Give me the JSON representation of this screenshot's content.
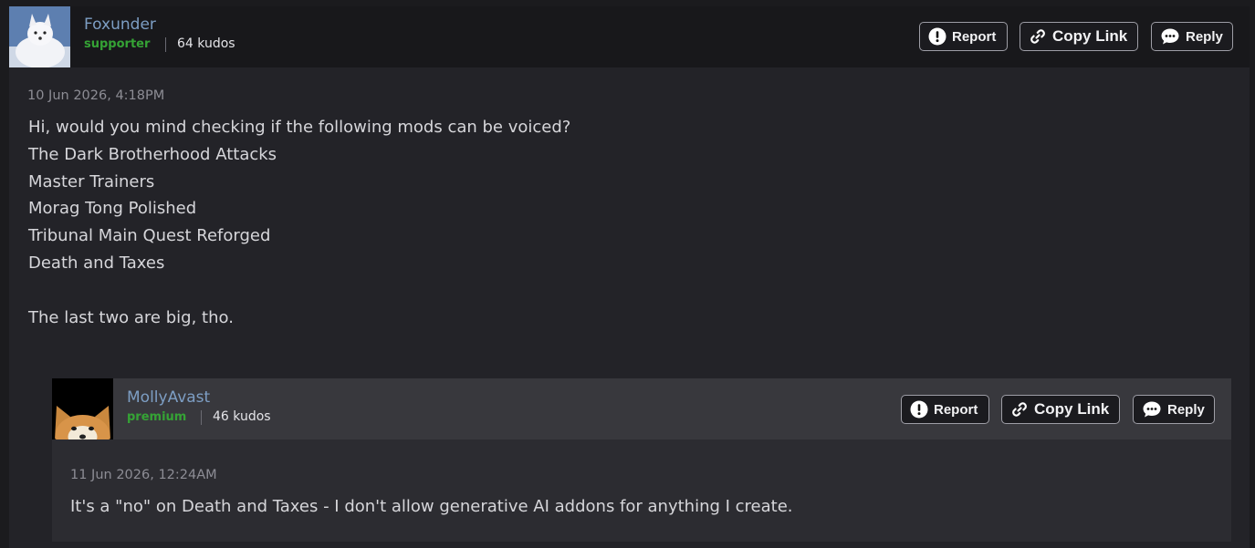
{
  "post": {
    "author": {
      "name": "Foxunder",
      "role": "supporter",
      "kudos": "64 kudos",
      "avatar_icon": "white-fox-avatar"
    },
    "timestamp": "10 Jun 2026, 4:18PM",
    "body": [
      "Hi, would you mind checking if the following mods can be voiced?",
      "The Dark Brotherhood Attacks",
      "Master Trainers",
      "Morag Tong Polished",
      "Tribunal Main Quest Reforged",
      "Death and Taxes",
      "The last two are big, tho."
    ],
    "actions": {
      "report": "Report",
      "copy_link": "Copy Link",
      "reply": "Reply"
    }
  },
  "reply": {
    "author": {
      "name": "MollyAvast",
      "role": "premium",
      "kudos": "46 kudos",
      "avatar_icon": "shiba-dog-avatar"
    },
    "timestamp": "11 Jun 2026, 12:24AM",
    "body": "It's a \"no\" on Death and Taxes - I don't allow generative AI addons for anything I create.",
    "actions": {
      "report": "Report",
      "copy_link": "Copy Link",
      "reply": "Reply"
    }
  },
  "colors": {
    "author_link": "#7d9ec4",
    "role_green": "#35a335",
    "panel": "#232328",
    "header": "#18181b",
    "reply_panel": "#2c2c31",
    "reply_header": "#38383d"
  }
}
